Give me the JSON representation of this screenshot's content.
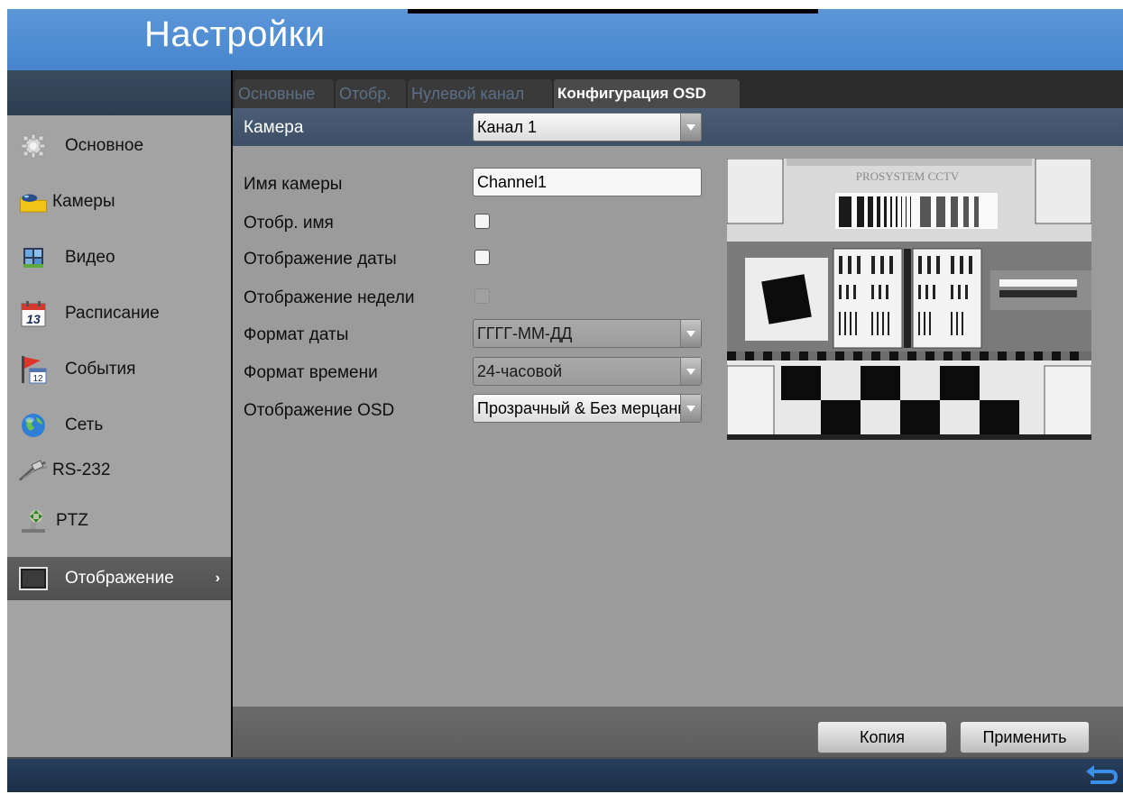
{
  "window": {
    "title": "Настройки"
  },
  "sidebar": {
    "items": [
      {
        "label": "Основное",
        "icon": "gear-icon"
      },
      {
        "label": "Камеры",
        "icon": "camera-icon"
      },
      {
        "label": "Видео",
        "icon": "video-icon"
      },
      {
        "label": "Расписание",
        "icon": "calendar-icon",
        "icon_text": "13"
      },
      {
        "label": "События",
        "icon": "flag-calendar-icon",
        "icon_text": "12"
      },
      {
        "label": "Сеть",
        "icon": "globe-icon"
      },
      {
        "label": "RS-232",
        "icon": "cable-icon"
      },
      {
        "label": "PTZ",
        "icon": "ptz-icon"
      },
      {
        "label": "Отображение",
        "icon": "monitor-icon",
        "active": true
      }
    ]
  },
  "tabs": [
    {
      "label": "Основные",
      "active": false
    },
    {
      "label": "Отобр.",
      "active": false
    },
    {
      "label": "Нулевой канал",
      "active": false
    },
    {
      "label": "Конфигурация OSD",
      "active": true
    }
  ],
  "form": {
    "camera": {
      "label": "Камера",
      "value": "Канал 1"
    },
    "camera_name": {
      "label": "Имя камеры",
      "value": "Channel1"
    },
    "show_name": {
      "label": "Отобр. имя",
      "checked": false
    },
    "show_date": {
      "label": "Отображение даты",
      "checked": false
    },
    "show_week": {
      "label": "Отображение недели",
      "checked": false,
      "disabled": true
    },
    "date_format": {
      "label": "Формат даты",
      "value": "ГГГГ-ММ-ДД"
    },
    "time_format": {
      "label": "Формат времени",
      "value": "24-часовой"
    },
    "osd_mode": {
      "label": "Отображение OSD",
      "value": "Прозрачный & Без мерцания"
    }
  },
  "preview": {
    "watermark": "PROSYSTEM CCTV"
  },
  "buttons": {
    "copy": "Копия",
    "apply": "Применить"
  },
  "colors": {
    "title_bar": "#4885cc",
    "sidebar_bg": "#a3a3a3",
    "main_bg": "#9b9b9b",
    "active_item": "#555555",
    "footer": "#1b2e46",
    "back_icon": "#3b8fe6"
  }
}
